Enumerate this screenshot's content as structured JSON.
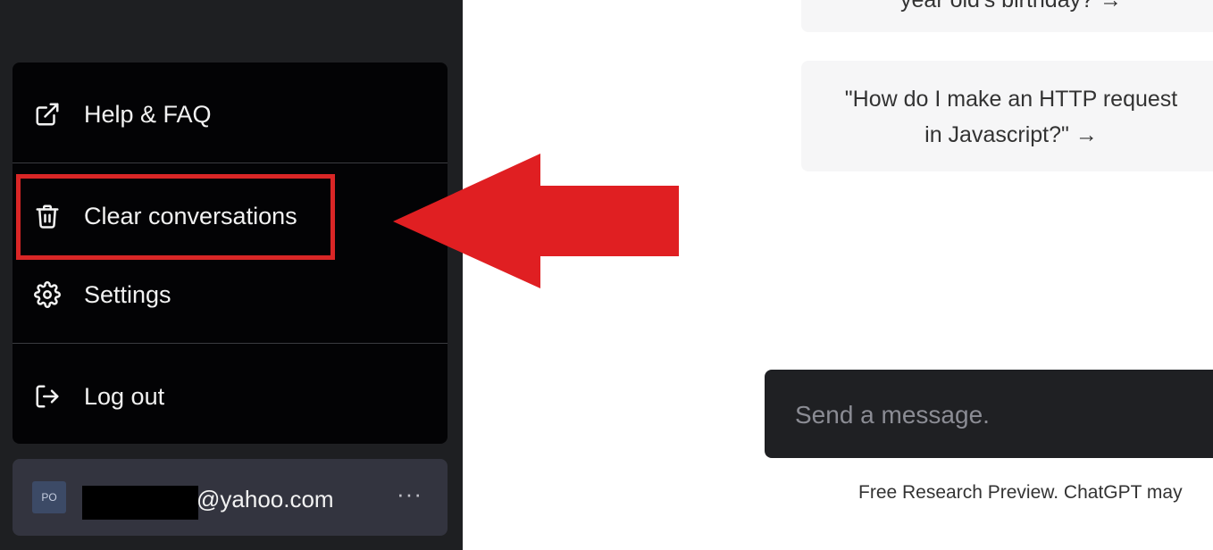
{
  "sidebar": {
    "menu": {
      "items": [
        {
          "label": "Help & FAQ",
          "icon": "external-link-icon"
        },
        {
          "label": "Clear conversations",
          "icon": "trash-icon"
        },
        {
          "label": "Settings",
          "icon": "gear-icon"
        },
        {
          "label": "Log out",
          "icon": "logout-icon"
        }
      ]
    },
    "account": {
      "avatar_initials": "PO",
      "email_suffix": "@yahoo.com",
      "more_label": "···"
    }
  },
  "main": {
    "suggestions": [
      {
        "text": "year old's birthday? →"
      },
      {
        "line1": "\"How do I make an HTTP request",
        "line2": "in Javascript?\" →"
      }
    ],
    "composer": {
      "placeholder": "Send a message."
    },
    "footer_note": "Free Research Preview. ChatGPT may"
  },
  "annotation": {
    "highlight_color": "#d92626",
    "arrow_color": "#e01f22"
  }
}
